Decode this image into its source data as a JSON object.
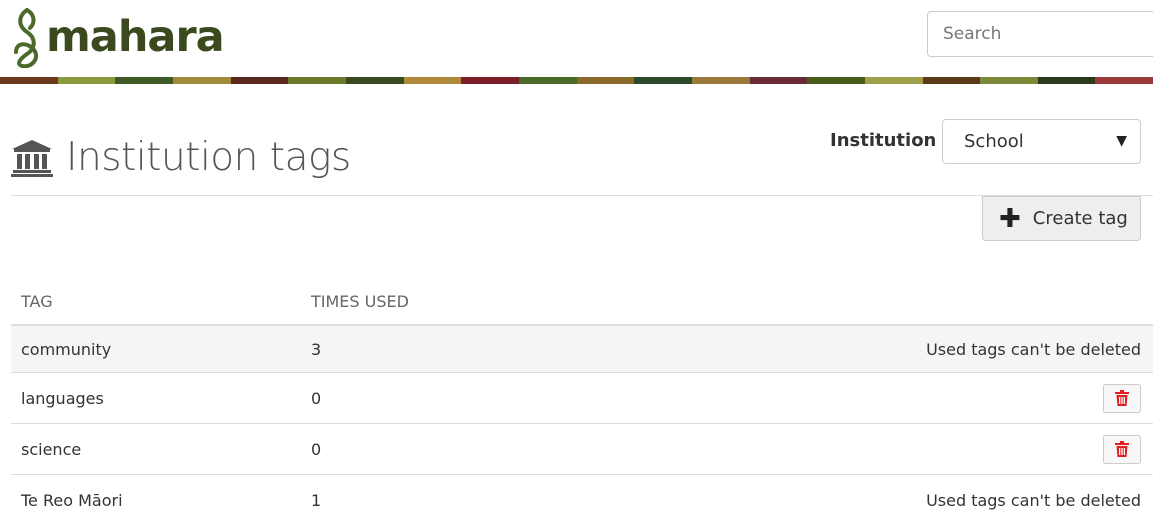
{
  "header": {
    "logo_text": "mahara",
    "search_placeholder": "Search",
    "banner_colors": [
      "#6b3a1f",
      "#8a9a3c",
      "#3f5a27",
      "#a08a3a",
      "#5a2a1e",
      "#6a7a2a",
      "#3a4a20",
      "#b08a3a",
      "#7a1e2a",
      "#4a6a2a",
      "#8a6a2a",
      "#2a4a2a",
      "#9a7a3a",
      "#6a2a3a",
      "#4a5a1a",
      "#a0a04a",
      "#5a3a1a",
      "#7a8a3a",
      "#2a3a1a",
      "#9a3a3a"
    ]
  },
  "page": {
    "title": "Institution tags",
    "institution_label": "Institution",
    "institution_selected": "School",
    "create_button_label": "Create tag"
  },
  "table": {
    "headers": {
      "tag": "TAG",
      "times_used": "TIMES USED"
    },
    "rows": [
      {
        "tag": "community",
        "times_used": "3",
        "action": "Used tags can't be deleted"
      },
      {
        "tag": "languages",
        "times_used": "0",
        "action": "delete"
      },
      {
        "tag": "science",
        "times_used": "0",
        "action": "delete"
      },
      {
        "tag": "Te Reo Māori",
        "times_used": "1",
        "action": "Used tags can't be deleted"
      }
    ]
  },
  "colors": {
    "brand": "#3b4a1e",
    "delete": "#e02020"
  }
}
